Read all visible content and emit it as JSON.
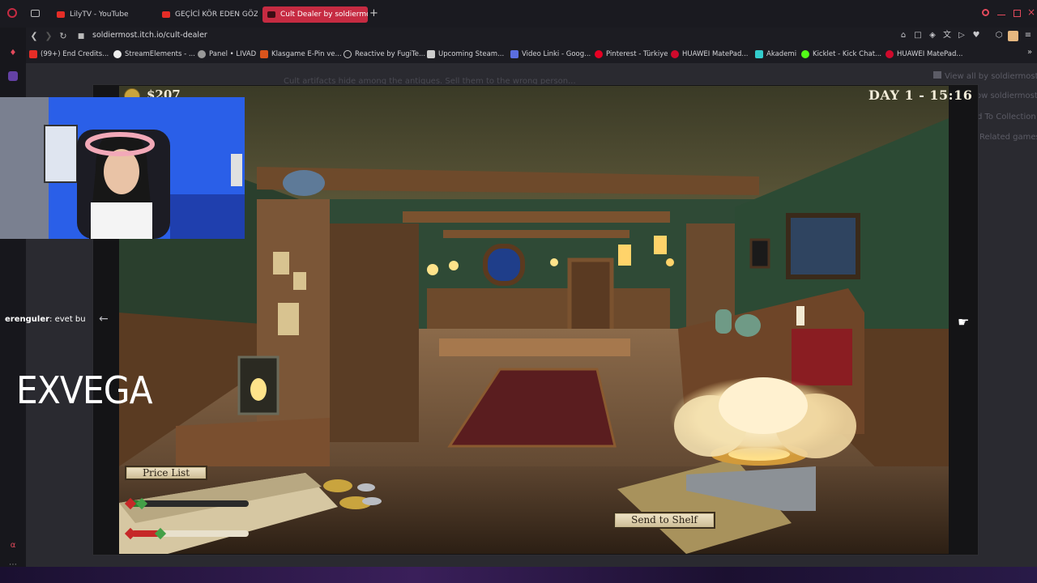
{
  "tabs": [
    {
      "label": "LilyTV - YouTube",
      "active": false
    },
    {
      "label": "GEÇİCİ KÖR EDEN GÖZ DA",
      "active": false
    },
    {
      "label": "Cult Dealer by soldiermost",
      "active": true
    }
  ],
  "address": {
    "url": "soldiermost.itch.io/cult-dealer"
  },
  "bookmarks": [
    "(99+) End Credits...",
    "StreamElements - ...",
    "Panel • LIVAD",
    "Klasgame E-Pin ve...",
    "Reactive by FugiTe...",
    "Upcoming Steam...",
    "Video Linki - Goog...",
    "Pinterest - Türkiye",
    "HUAWEI MatePad...",
    "Akademi",
    "Kicklet - Kick Chat...",
    "HUAWEI MatePad..."
  ],
  "itch": {
    "hint_text": "Cult artifacts hide among the antiques. Sell them to the wrong person...",
    "view_all": "View all by soldiermost",
    "follow": "ow soldiermost",
    "collection": "d To Collection",
    "related": "Related games"
  },
  "game": {
    "money": "$207",
    "day": "DAY 1 - 15:16",
    "price_list_label": "Price List",
    "send_to_shelf_label": "Send to Shelf",
    "bar_fill_1": 0.12,
    "bar_fill_2": 0.25
  },
  "chat": {
    "user": "erenguler",
    "message": ": evet bu"
  },
  "overlay": {
    "logo": "EXVEGA"
  },
  "colors": {
    "accent": "#c62b42",
    "tab_bg": "#1a1a20",
    "game_wall": "#2f4a36"
  },
  "icons": {
    "back": "arrow-left-icon",
    "forward": "arrow-right-icon",
    "reload": "reload-icon",
    "lock": "lock-icon"
  }
}
